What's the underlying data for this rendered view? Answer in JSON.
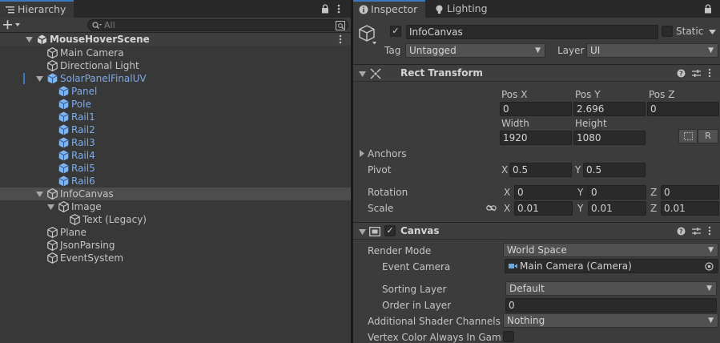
{
  "hierarchy": {
    "tab_label": "Hierarchy",
    "search_placeholder": "All",
    "scene_name": "MouseHoverScene",
    "items": [
      {
        "label": "Main Camera"
      },
      {
        "label": "Directional Light"
      },
      {
        "label": "SolarPanelFinalUV"
      },
      {
        "label": "Panel"
      },
      {
        "label": "Pole"
      },
      {
        "label": "Rail1"
      },
      {
        "label": "Rail2"
      },
      {
        "label": "Rail3"
      },
      {
        "label": "Rail4"
      },
      {
        "label": "Rail5"
      },
      {
        "label": "Rail6"
      },
      {
        "label": "InfoCanvas"
      },
      {
        "label": "Image"
      },
      {
        "label": "Text (Legacy)"
      },
      {
        "label": "Plane"
      },
      {
        "label": "JsonParsing"
      },
      {
        "label": "EventSystem"
      }
    ]
  },
  "inspector": {
    "tab_inspector": "Inspector",
    "tab_lighting": "Lighting",
    "object_name": "InfoCanvas",
    "static_label": "Static",
    "tag_label": "Tag",
    "tag_value": "Untagged",
    "layer_label": "Layer",
    "layer_value": "UI",
    "rect_transform": {
      "title": "Rect Transform",
      "pos_x_label": "Pos X",
      "pos_x": "0",
      "pos_y_label": "Pos Y",
      "pos_y": "2.696",
      "pos_z_label": "Pos Z",
      "pos_z": "0",
      "width_label": "Width",
      "width": "1920",
      "height_label": "Height",
      "height": "1080",
      "r_button": "R",
      "anchors_label": "Anchors",
      "pivot_label": "Pivot",
      "pivot_x": "0.5",
      "pivot_y": "0.5",
      "rotation_label": "Rotation",
      "rot_x": "0",
      "rot_y": "0",
      "rot_z": "0",
      "scale_label": "Scale",
      "scale_x": "0.01",
      "scale_y": "0.01",
      "scale_z": "0.01",
      "x": "X",
      "y": "Y",
      "z": "Z"
    },
    "canvas": {
      "title": "Canvas",
      "render_mode_label": "Render Mode",
      "render_mode": "World Space",
      "event_camera_label": "Event Camera",
      "event_camera": "Main Camera (Camera)",
      "sorting_layer_label": "Sorting Layer",
      "sorting_layer": "Default",
      "order_label": "Order in Layer",
      "order": "0",
      "shader_channels_label": "Additional Shader Channels",
      "shader_channels": "Nothing",
      "vertex_color_label": "Vertex Color Always In Gamma"
    }
  },
  "colors": {
    "accent": "#3a79bb",
    "prefab_blue": "#7fa9e8"
  }
}
